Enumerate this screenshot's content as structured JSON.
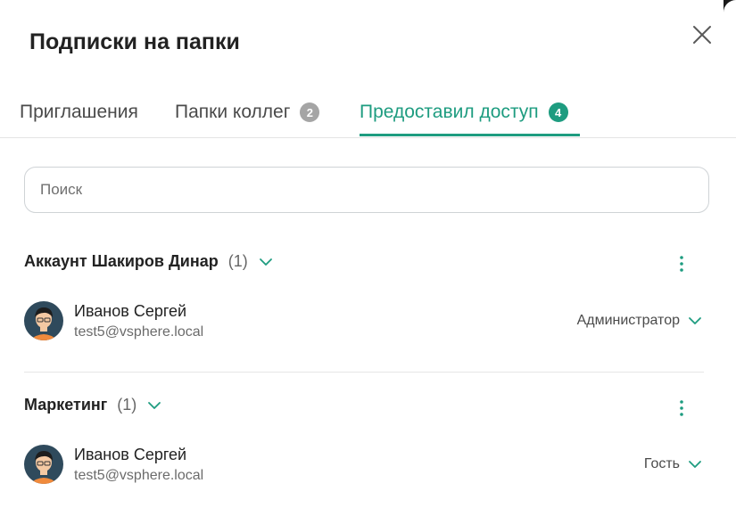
{
  "dialog": {
    "title": "Подписки на папки"
  },
  "tabs": [
    {
      "label": "Приглашения",
      "badge": ""
    },
    {
      "label": "Папки коллег",
      "badge": "2"
    },
    {
      "label": "Предоставил доступ",
      "badge": "4"
    }
  ],
  "active_tab": 2,
  "search": {
    "placeholder": "Поиск",
    "value": ""
  },
  "groups": [
    {
      "name": "Аккаунт Шакиров Динар",
      "count": "(1)",
      "users": [
        {
          "name": "Иванов Сергей",
          "email": "test5@vsphere.local",
          "role": "Администратор"
        }
      ]
    },
    {
      "name": "Маркетинг",
      "count": "(1)",
      "users": [
        {
          "name": "Иванов Сергей",
          "email": "test5@vsphere.local",
          "role": "Гость"
        }
      ]
    }
  ],
  "colors": {
    "accent": "#1e9c80",
    "badge_inactive": "#a5a5a5",
    "text": "#222222",
    "muted": "#6b6b6b"
  },
  "icons": [
    "close-icon",
    "chevron-down-icon",
    "more-vertical-icon",
    "user-avatar"
  ]
}
